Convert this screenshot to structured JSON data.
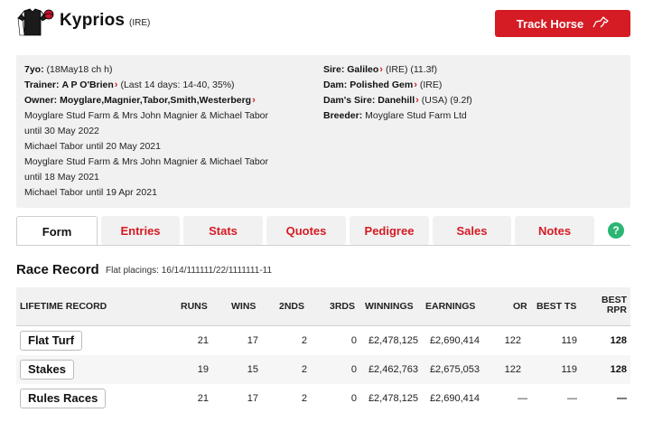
{
  "header": {
    "horse_name": "Kyprios",
    "country": "(IRE)",
    "track_button": "Track Horse",
    "track_icon": "horse-icon"
  },
  "info": {
    "age_label": "7yo:",
    "age_value": "(18May18 ch h)",
    "trainer_label": "Trainer:",
    "trainer_name": "A P O'Brien",
    "trainer_stats": "(Last 14 days: 14-40, 35%)",
    "owner_label": "Owner:",
    "owner_name": "Moyglare,Magnier,Tabor,Smith,Westerberg",
    "history": [
      "Moyglare Stud Farm & Mrs John Magnier & Michael Tabor",
      "until 30 May 2022",
      "Michael Tabor until 20 May 2021",
      "Moyglare Stud Farm & Mrs John Magnier & Michael Tabor",
      "until 18 May 2021",
      "Michael Tabor until 19 Apr 2021"
    ],
    "sire_label": "Sire:",
    "sire_name": "Galileo",
    "sire_extra": "(IRE) (11.3f)",
    "dam_label": "Dam:",
    "dam_name": "Polished Gem",
    "dam_extra": "(IRE)",
    "damsire_label": "Dam's Sire:",
    "damsire_name": "Danehill",
    "damsire_extra": "(USA) (9.2f)",
    "breeder_label": "Breeder:",
    "breeder_name": "Moyglare Stud Farm Ltd"
  },
  "tabs": [
    {
      "label": "Form",
      "active": true
    },
    {
      "label": "Entries"
    },
    {
      "label": "Stats"
    },
    {
      "label": "Quotes"
    },
    {
      "label": "Pedigree"
    },
    {
      "label": "Sales"
    },
    {
      "label": "Notes"
    }
  ],
  "help_icon": "?",
  "race_record": {
    "title": "Race Record",
    "flat_placings": "Flat placings: 16/14/111111/22/1111111-11"
  },
  "table": {
    "headers": {
      "record": "LIFETIME RECORD",
      "runs": "RUNS",
      "wins": "WINS",
      "seconds": "2NDS",
      "thirds": "3RDS",
      "winnings": "WINNINGS",
      "earnings": "EARNINGS",
      "or": "OR",
      "best_ts": "BEST TS",
      "best_rpr_1": "BEST",
      "best_rpr_2": "RPR"
    },
    "rows": [
      {
        "name": "Flat Turf",
        "runs": "21",
        "wins": "17",
        "seconds": "2",
        "thirds": "0",
        "winnings": "£2,478,125",
        "earnings": "£2,690,414",
        "or": "122",
        "ts": "119",
        "rpr": "128"
      },
      {
        "name": "Stakes",
        "runs": "19",
        "wins": "15",
        "seconds": "2",
        "thirds": "0",
        "winnings": "£2,462,763",
        "earnings": "£2,675,053",
        "or": "122",
        "ts": "119",
        "rpr": "128"
      },
      {
        "name": "Rules Races",
        "runs": "21",
        "wins": "17",
        "seconds": "2",
        "thirds": "0",
        "winnings": "£2,478,125",
        "earnings": "£2,690,414",
        "or": "—",
        "ts": "—",
        "rpr": "—"
      }
    ]
  },
  "colors": {
    "accent": "#d51b23",
    "panel": "#f1f1f1",
    "help": "#2bb673"
  }
}
